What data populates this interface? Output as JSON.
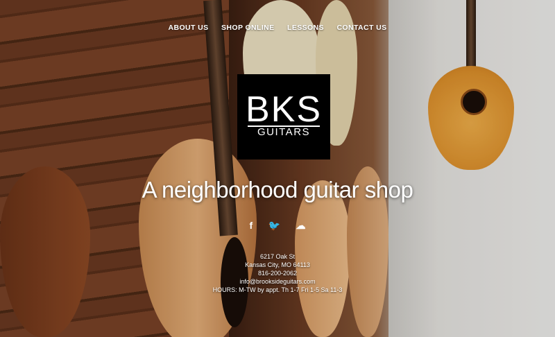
{
  "nav": {
    "items": [
      "ABOUT US",
      "SHOP ONLINE",
      "LESSONS",
      "CONTACT US"
    ]
  },
  "logo": {
    "main": "BKS",
    "sub": "GUITARS"
  },
  "tagline": "A neighborhood guitar shop",
  "social": {
    "facebook": "f",
    "twitter": "🐦",
    "soundcloud": "☁"
  },
  "contact": {
    "street": "6217 Oak St",
    "city": "Kansas City, MO 64113",
    "phone": "816-200-2062",
    "email": "info@brooksideguitars.com",
    "hours": "HOURS: M-TW by appt. Th 1-7 Fri 1-5 Sa 11-3"
  },
  "colors": {
    "logo_bg": "#000000",
    "text": "#ffffff"
  }
}
